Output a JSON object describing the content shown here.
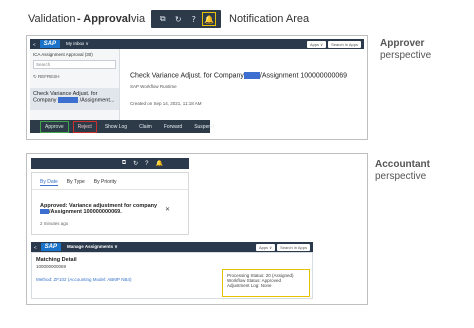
{
  "header": {
    "prefix": "Validation",
    "approval": "- Approval",
    "via": "via",
    "suffix": "Notification Area",
    "icons": [
      "copy-icon",
      "refresh-icon",
      "help-icon",
      "bell-icon"
    ],
    "highlight_color": "#e6c200"
  },
  "approver": {
    "label_bold": "Approver",
    "label": "perspective",
    "shell": {
      "back": "<",
      "logo": "SAP",
      "title": "My Inbox ∨",
      "apps": "Apps ∨",
      "search": "Search in Apps"
    },
    "list": {
      "header": "ICA Assignment Approval (30)",
      "search_placeholder": "Search",
      "refresh": "REFRESH",
      "item_line1": "Check Variance Adjust. for",
      "item_line2_a": "Company",
      "item_line2_b": "/Assignment..."
    },
    "detail": {
      "title_a": "Check Variance Adjust. for Company",
      "title_b": "/Assignment 100000000069",
      "subtitle": "SAP Workflow Runtime",
      "created": "Created on Sep 14, 2021, 11:18 AM"
    },
    "footer": [
      "Approve",
      "Reject",
      "Show Log",
      "Claim",
      "Forward",
      "Suspend"
    ]
  },
  "accountant": {
    "label_bold": "Accountant",
    "label": "perspective",
    "tabs": [
      "By Date",
      "By Type",
      "By Priority"
    ],
    "notification": {
      "line1": "Approved: Variance adjustment for company",
      "line2": "/Assignment 100000000069.",
      "time": "2 minutes ago",
      "close": "✕"
    },
    "shell": {
      "back": "<",
      "logo": "SAP",
      "title": "Manage Assignments ∨",
      "apps": "Apps ∨",
      "search": "Search in Apps"
    },
    "detail": {
      "title": "Matching Detail",
      "number": "100000000069",
      "method": "Method: ZF102 (Accounting Model: ABMP NB4)",
      "status_lines": [
        "Processing Status: 20 (Assigned)",
        "Workflow Status: Approved",
        "Adjustment Log: None"
      ]
    }
  }
}
